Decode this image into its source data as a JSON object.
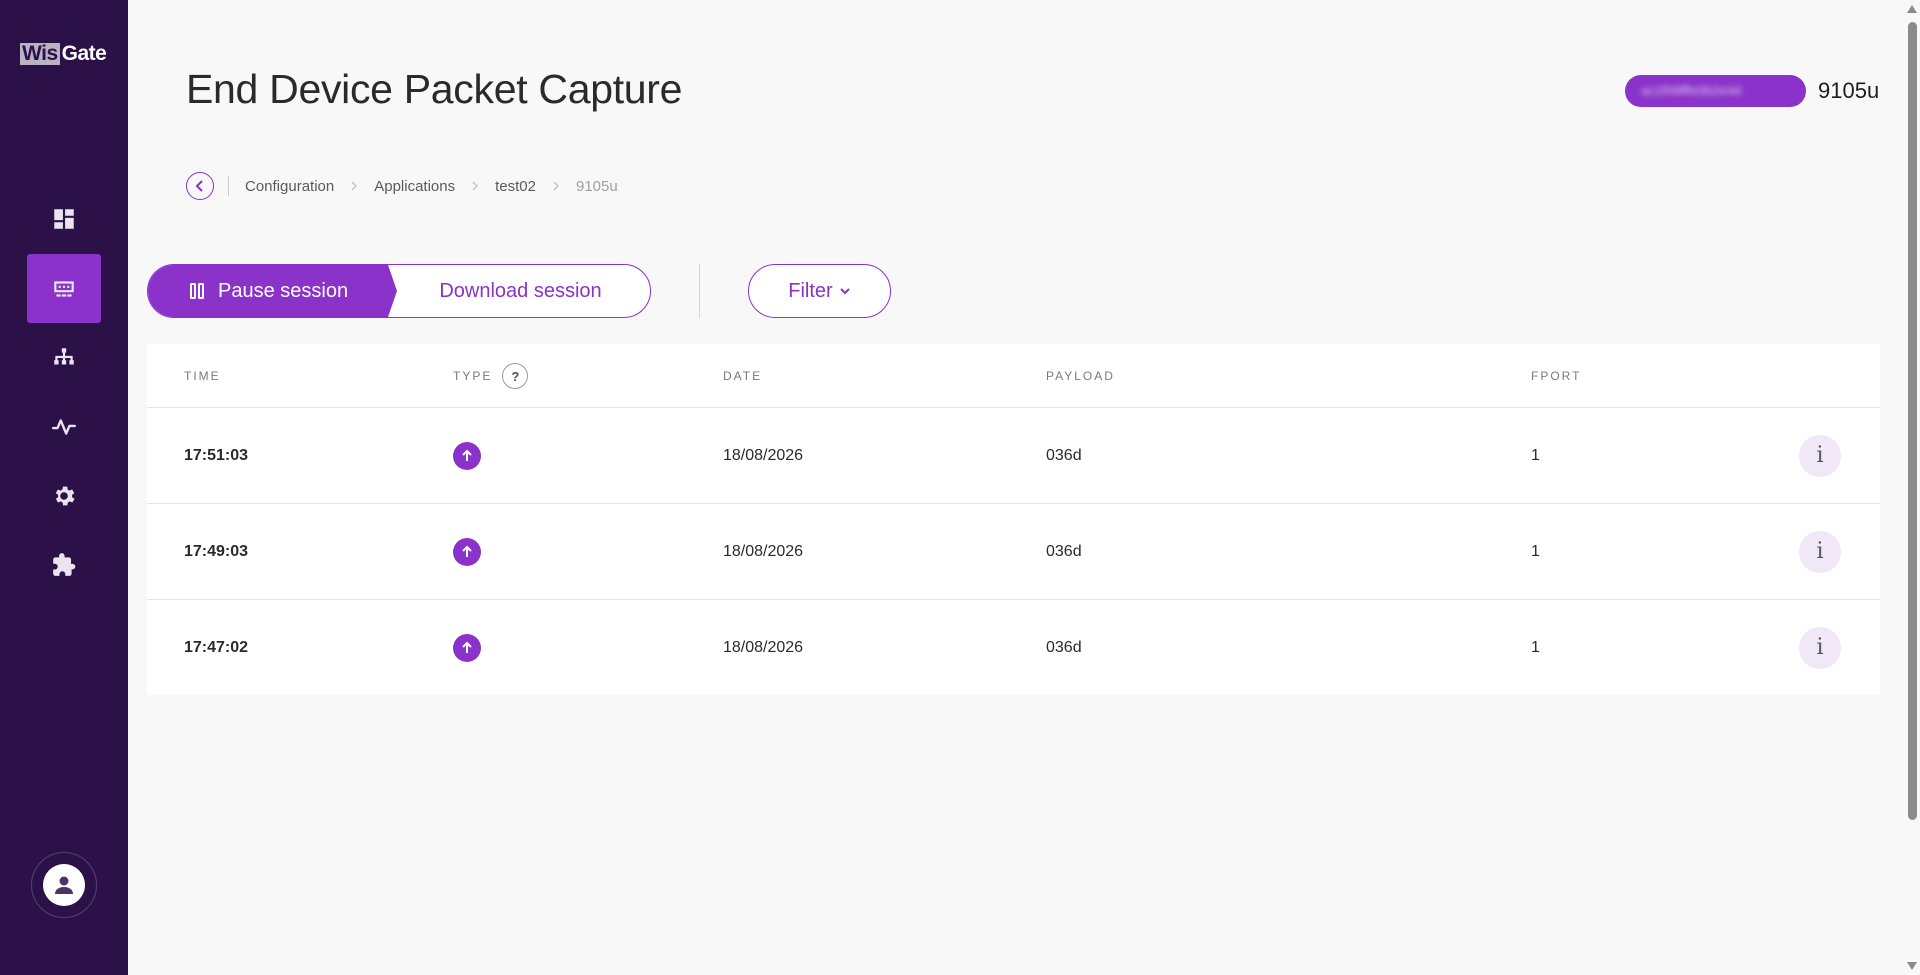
{
  "logo": {
    "part1": "Wis",
    "part2": "Gate"
  },
  "sidebar": {
    "items": [
      {
        "name": "dashboard",
        "icon": "dashboard-icon"
      },
      {
        "name": "gateway",
        "icon": "gateway-icon",
        "active": true
      },
      {
        "name": "network",
        "icon": "network-icon"
      },
      {
        "name": "activity",
        "icon": "activity-icon"
      },
      {
        "name": "settings",
        "icon": "gear-icon"
      },
      {
        "name": "extensions",
        "icon": "puzzle-icon"
      }
    ],
    "user_icon": "user-icon"
  },
  "header": {
    "title": "End Device Packet Capture",
    "device_eui": "ac1f09fffe0b2e4d",
    "device_name": "9105u"
  },
  "breadcrumb": {
    "items": [
      "Configuration",
      "Applications",
      "test02"
    ],
    "current": "9105u"
  },
  "toolbar": {
    "pause_label": "Pause session",
    "download_label": "Download session",
    "filter_label": "Filter"
  },
  "table": {
    "columns": {
      "time": "TIME",
      "type": "TYPE",
      "type_help": "?",
      "date": "DATE",
      "payload": "PAYLOAD",
      "fport": "FPORT"
    },
    "rows": [
      {
        "time": "17:51:03",
        "type": "uplink",
        "date": "18/08/2026",
        "payload": "036d",
        "fport": "1",
        "info": "i"
      },
      {
        "time": "17:49:03",
        "type": "uplink",
        "date": "18/08/2026",
        "payload": "036d",
        "fport": "1",
        "info": "i"
      },
      {
        "time": "17:47:02",
        "type": "uplink",
        "date": "18/08/2026",
        "payload": "036d",
        "fport": "1",
        "info": "i"
      }
    ]
  },
  "colors": {
    "sidebar_bg": "#2c1148",
    "accent": "#8a32c9",
    "info_bg": "#f1e8f7",
    "page_bg": "#f8f8f8"
  }
}
